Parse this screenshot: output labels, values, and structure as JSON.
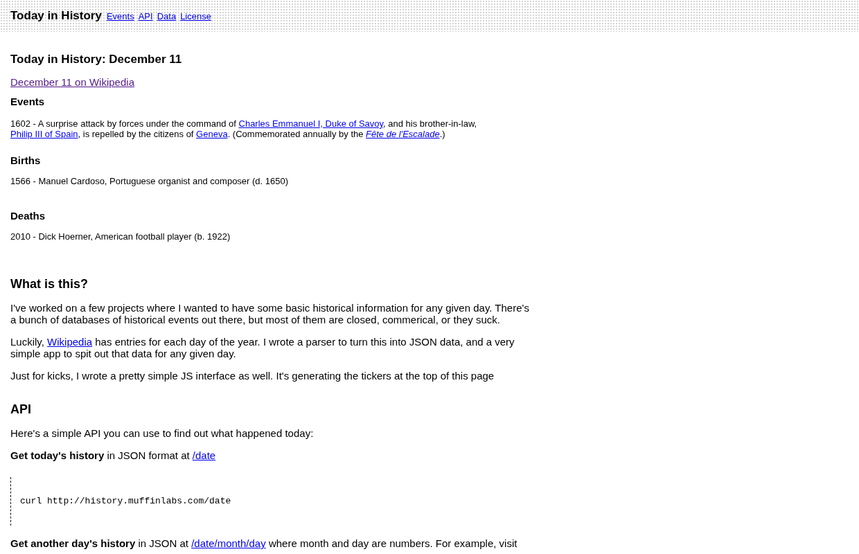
{
  "header": {
    "title": "Today in History",
    "nav": [
      "Events",
      "API",
      "Data",
      "License"
    ]
  },
  "page_title": "Today in History: December 11",
  "wiki_link": {
    "text": "December 11 on Wikipedia",
    "visited": true
  },
  "sections": [
    {
      "heading": "Events",
      "items": [
        [
          {
            "kind": "text",
            "text": "1602 - A surprise attack by forces under the command of "
          },
          {
            "kind": "link",
            "text": "Charles Emmanuel I, Duke of Savoy"
          },
          {
            "kind": "text",
            "text": ", and his brother-in-law, "
          },
          {
            "kind": "link",
            "text": "Philip III of Spain"
          },
          {
            "kind": "text",
            "text": ", is repelled by the citizens of "
          },
          {
            "kind": "link",
            "text": "Geneva"
          },
          {
            "kind": "text",
            "text": ". (Commemorated annually by the "
          },
          {
            "kind": "italic_link",
            "text": "Fête de l'Escalade"
          },
          {
            "kind": "text",
            "text": ".)"
          }
        ]
      ]
    },
    {
      "heading": "Births",
      "items": [
        [
          {
            "kind": "text",
            "text": "1566 - Manuel Cardoso, Portuguese organist and composer (d. 1650)"
          }
        ]
      ]
    },
    {
      "heading": "Deaths",
      "items": [
        [
          {
            "kind": "text",
            "text": "2010 - Dick Hoerner, American football player (b. 1922)"
          }
        ]
      ]
    }
  ],
  "about": {
    "heading": "What is this?",
    "paragraphs": [
      [
        {
          "kind": "text",
          "text": "I've worked on a few projects where I wanted to have some basic historical information for any given day. There's a bunch of databases of historical events out there, but most of them are closed, commerical, or they suck."
        }
      ],
      [
        {
          "kind": "text",
          "text": "Luckily, "
        },
        {
          "kind": "link",
          "text": "Wikipedia"
        },
        {
          "kind": "text",
          "text": " has entries for each day of the year. I wrote a parser to turn this into JSON data, and a very simple app to spit out that data for any given day."
        }
      ],
      [
        {
          "kind": "text",
          "text": "Just for kicks, I wrote a pretty simple JS interface as well. It's generating the tickers at the top of this page"
        }
      ]
    ]
  },
  "api": {
    "heading": "API",
    "blocks": [
      {
        "kind": "para",
        "parts": [
          {
            "kind": "text",
            "text": "Here's a simple API you can use to find out what happened today:"
          }
        ]
      },
      {
        "kind": "para",
        "parts": [
          {
            "kind": "bold",
            "text": "Get today's history"
          },
          {
            "kind": "text",
            "text": " in JSON format at "
          },
          {
            "kind": "link",
            "text": "/date"
          }
        ]
      },
      {
        "kind": "code",
        "text": "curl http://history.muffinlabs.com/date"
      },
      {
        "kind": "para",
        "parts": [
          {
            "kind": "bold",
            "text": "Get another day's history"
          },
          {
            "kind": "text",
            "text": " in JSON at "
          },
          {
            "kind": "link",
            "text": "/date/month/day"
          },
          {
            "kind": "text",
            "text": " where month and day are numbers. For example, visit"
          }
        ]
      }
    ]
  }
}
